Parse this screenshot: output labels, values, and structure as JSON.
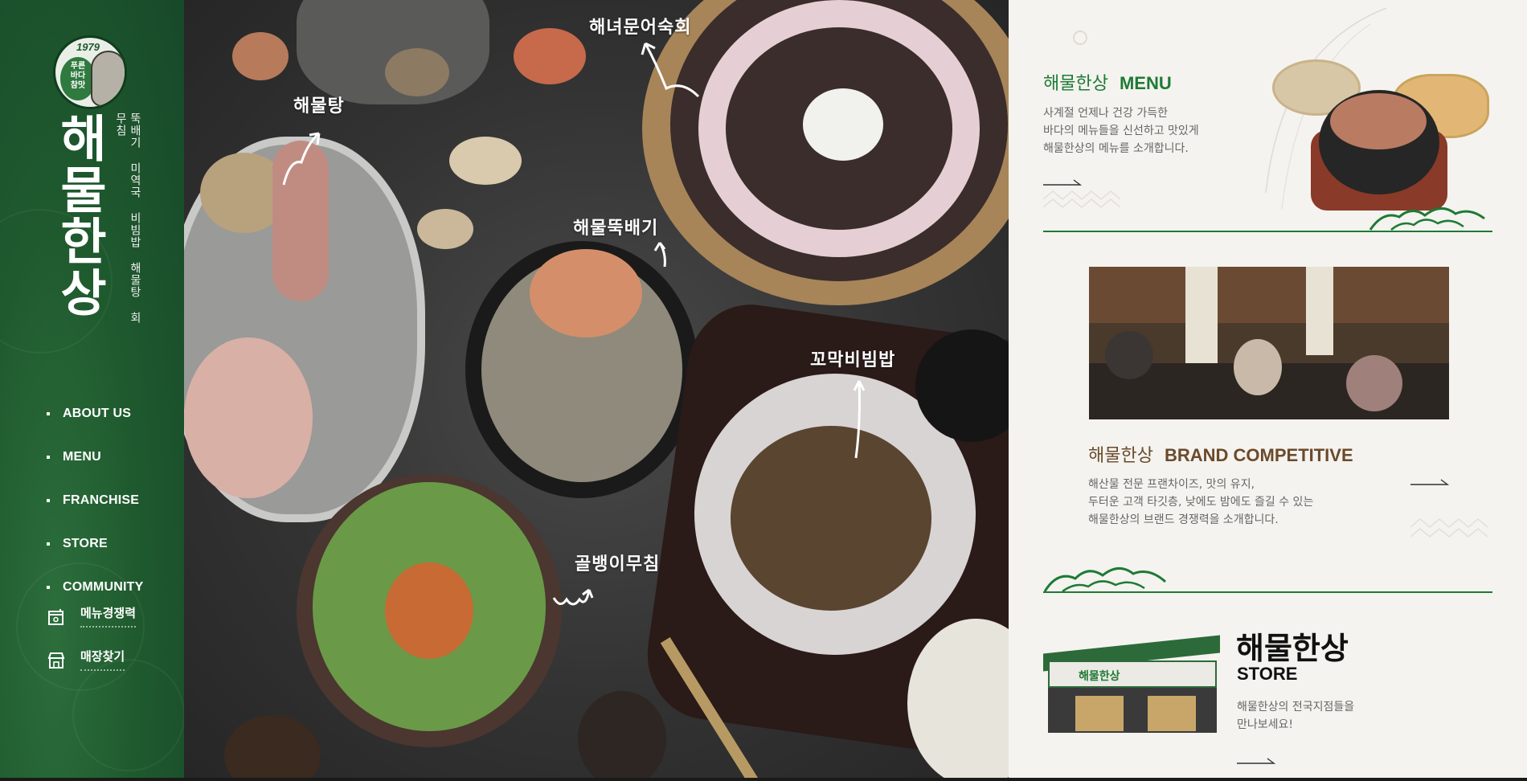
{
  "sidebar": {
    "badge": {
      "year": "1979",
      "text": "푸른\n바다\n참맛"
    },
    "brand_title": "해물한상",
    "brand_subtitle": "뚝배기 미역국 비빔밥 해물탕 회무침",
    "nav": [
      {
        "label": "ABOUT US"
      },
      {
        "label": "MENU"
      },
      {
        "label": "FRANCHISE"
      },
      {
        "label": "STORE"
      },
      {
        "label": "COMMUNITY"
      }
    ],
    "quick_links": [
      {
        "label": "메뉴경쟁력",
        "icon": "menu-board-icon"
      },
      {
        "label": "매장찾기",
        "icon": "storefront-icon"
      }
    ]
  },
  "hero": {
    "labels": {
      "octopus_sashimi": "해녀문어숙회",
      "seafood_stew": "해물탕",
      "seafood_ttukbaegi": "해물뚝배기",
      "cockle_bibimbap": "꼬막비빔밥",
      "whelk_salad": "골뱅이무침"
    }
  },
  "right": {
    "menu": {
      "title_ko": "해물한상",
      "title_en": "MENU",
      "desc": "사계절 언제나 건강 가득한\n바다의 메뉴들을 신선하고 맛있게\n해물한상의 메뉴를 소개합니다."
    },
    "brand": {
      "title_ko": "해물한상",
      "title_en": "BRAND COMPETITIVE",
      "desc": "해산물 전문 프랜차이즈, 맛의 유지,\n두터운 고객 타깃층, 낮에도 밤에도 즐길 수 있는\n해물한상의 브랜드 경쟁력을 소개합니다."
    },
    "store": {
      "title_ko": "해물한상",
      "title_en": "STORE",
      "desc": "해물한상의 전국지점들을\n만나보세요!",
      "sign_text": "해물한상"
    }
  },
  "colors": {
    "brand_green": "#1f5a2e",
    "accent_green": "#1e7a35",
    "brand_brown": "#6b4a2b",
    "panel_bg": "#f4f3ef"
  }
}
